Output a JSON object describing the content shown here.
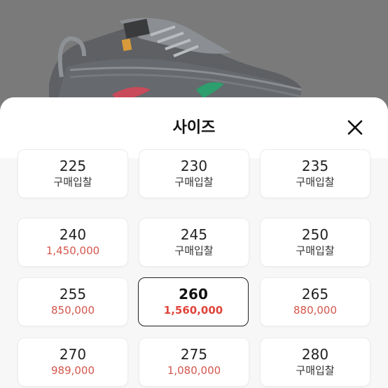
{
  "colors": {
    "price": "#d4564d",
    "selected_border": "#222222",
    "backdrop": "#7a7a7a"
  },
  "background": {
    "image": "sneaker-product-photo"
  },
  "sheet": {
    "title": "사이즈",
    "close_icon": "close-icon"
  },
  "sizes": [
    {
      "size": "225",
      "sub": "구매입찰",
      "type": "bid"
    },
    {
      "size": "230",
      "sub": "구매입찰",
      "type": "bid"
    },
    {
      "size": "235",
      "sub": "구매입찰",
      "type": "bid"
    },
    {
      "size": "240",
      "sub": "1,450,000",
      "type": "price"
    },
    {
      "size": "245",
      "sub": "구매입찰",
      "type": "bid"
    },
    {
      "size": "250",
      "sub": "구매입찰",
      "type": "bid"
    },
    {
      "size": "255",
      "sub": "850,000",
      "type": "price"
    },
    {
      "size": "260",
      "sub": "1,560,000",
      "type": "price",
      "selected": true
    },
    {
      "size": "265",
      "sub": "880,000",
      "type": "price"
    },
    {
      "size": "270",
      "sub": "989,000",
      "type": "price"
    },
    {
      "size": "275",
      "sub": "1,080,000",
      "type": "price"
    },
    {
      "size": "280",
      "sub": "구매입찰",
      "type": "bid"
    }
  ]
}
